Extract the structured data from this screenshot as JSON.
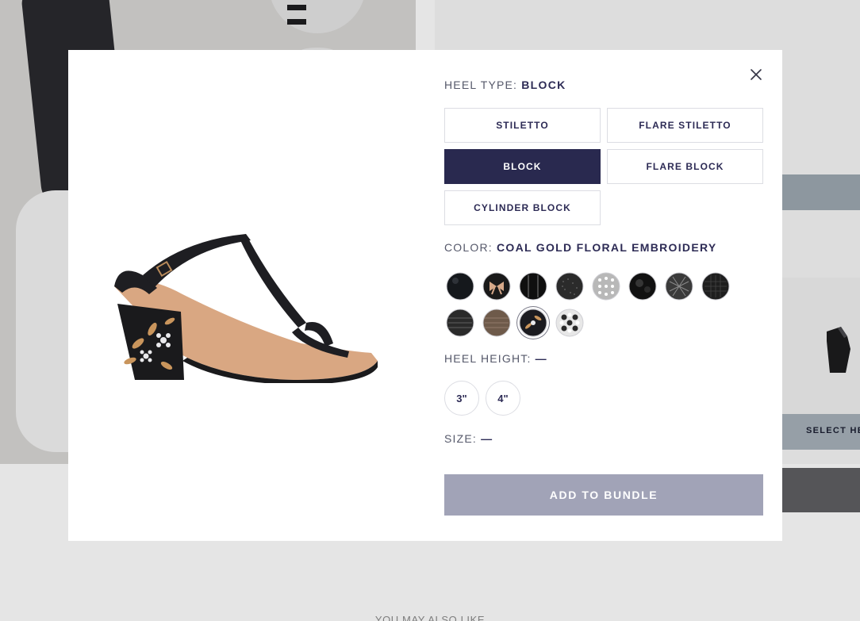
{
  "background": {
    "select_bar_label": "SELECT HE",
    "also_like": "YOU MAY ALSO LIKE"
  },
  "modal": {
    "heel_type": {
      "label": "HEEL TYPE:",
      "selected": "BLOCK",
      "options": [
        "STILETTO",
        "FLARE STILETTO",
        "BLOCK",
        "FLARE BLOCK",
        "CYLINDER BLOCK"
      ]
    },
    "color": {
      "label": "COLOR:",
      "selected": "COAL GOLD FLORAL EMBROIDERY",
      "swatches": [
        {
          "icon": "solid-black-swatch",
          "color": "#15181c"
        },
        {
          "icon": "bow-swatch",
          "color": "#1a1a1a"
        },
        {
          "icon": "patent-black-swatch",
          "color": "#0f0f0f"
        },
        {
          "icon": "textured-black-swatch",
          "color": "#2b2b2b"
        },
        {
          "icon": "silver-dots-swatch",
          "color": "#b8b8b8"
        },
        {
          "icon": "glossy-black-swatch",
          "color": "#111111"
        },
        {
          "icon": "tweed-swatch",
          "color": "#3a3a3a"
        },
        {
          "icon": "mesh-black-swatch",
          "color": "#1e1e1e"
        },
        {
          "icon": "striped-black-swatch",
          "color": "#2a2a2a"
        },
        {
          "icon": "bronze-swatch",
          "color": "#6e5a4a"
        },
        {
          "icon": "floral-embroidery-swatch",
          "color": "#1b1b20"
        },
        {
          "icon": "pearl-swatch",
          "color": "#e7e7e7"
        }
      ]
    },
    "heel_height": {
      "label": "HEEL HEIGHT:",
      "selected": "—",
      "options": [
        "3\"",
        "4\""
      ]
    },
    "size": {
      "label": "SIZE:",
      "selected": "—"
    },
    "add_to_bundle": "ADD TO BUNDLE"
  }
}
